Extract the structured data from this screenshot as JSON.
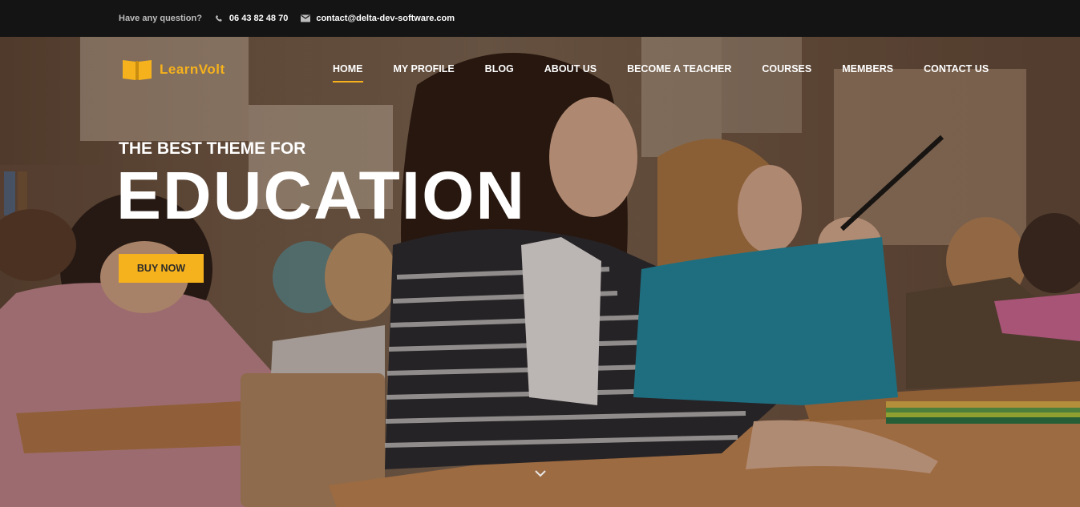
{
  "topbar": {
    "question": "Have any question?",
    "phone": "06 43 82 48 70",
    "email": "contact@delta-dev-software.com",
    "phone_icon": "phone-icon",
    "email_icon": "envelope-icon"
  },
  "header": {
    "logo_text": "LearnVolt",
    "logo_icon": "open-book-icon",
    "nav": [
      {
        "label": "HOME",
        "active": true
      },
      {
        "label": "MY PROFILE"
      },
      {
        "label": "BLOG"
      },
      {
        "label": "ABOUT US"
      },
      {
        "label": "BECOME A TEACHER"
      },
      {
        "label": "COURSES"
      },
      {
        "label": "MEMBERS"
      },
      {
        "label": "CONTACT US"
      }
    ]
  },
  "hero": {
    "subtitle": "THE BEST THEME FOR",
    "title": "EDUCATION",
    "button_label": "BUY NOW",
    "scroll_icon": "chevron-down-icon"
  },
  "colors": {
    "accent": "#f6b21c",
    "topbar_bg": "#141414"
  }
}
